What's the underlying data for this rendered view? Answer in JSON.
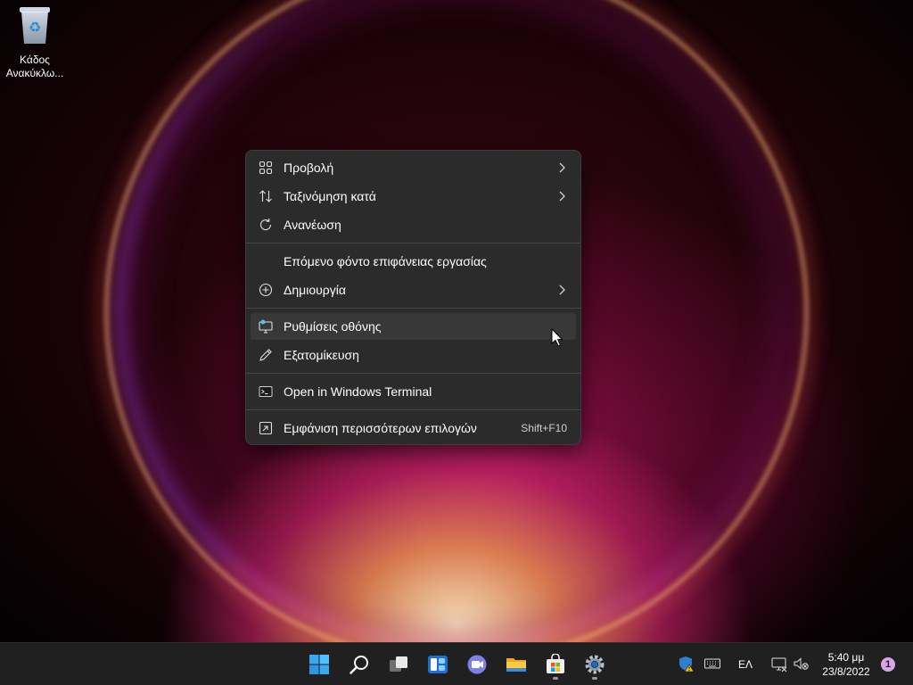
{
  "desktop": {
    "recycle_bin": {
      "label_line1": "Κάδος",
      "label_line2": "Ανακύκλω..."
    }
  },
  "context_menu": {
    "items": [
      {
        "label": "Προβολή",
        "icon": "view-grid-icon",
        "submenu": true
      },
      {
        "label": "Ταξινόμηση κατά",
        "icon": "sort-icon",
        "submenu": true
      },
      {
        "label": "Ανανέωση",
        "icon": "refresh-icon",
        "submenu": false
      },
      {
        "label": "Επόμενο φόντο επιφάνειας εργασίας",
        "icon": "",
        "submenu": false
      },
      {
        "label": "Δημιουργία",
        "icon": "new-icon",
        "submenu": true
      },
      {
        "label": "Ρυθμίσεις οθόνης",
        "icon": "display-settings-icon",
        "submenu": false,
        "hovered": true
      },
      {
        "label": "Εξατομίκευση",
        "icon": "personalize-pen-icon",
        "submenu": false
      },
      {
        "label": "Open in Windows Terminal",
        "icon": "terminal-icon",
        "submenu": false
      },
      {
        "label": "Εμφάνιση περισσότερων επιλογών",
        "icon": "more-options-icon",
        "shortcut": "Shift+F10"
      }
    ]
  },
  "taskbar": {
    "apps": [
      "start-icon",
      "search-icon",
      "task-view-icon",
      "widgets-icon",
      "teams-chat-icon",
      "file-explorer-icon",
      "microsoft-store-icon",
      "settings-icon"
    ],
    "tray": {
      "language": "ΕΛ",
      "time": "5:40 μμ",
      "date": "23/8/2022",
      "notification_count": "1"
    }
  },
  "colors": {
    "menu_bg": "#2b2b2b",
    "menu_hover": "#383838",
    "taskbar_bg": "#202020",
    "accent": "#4cc2ff"
  }
}
